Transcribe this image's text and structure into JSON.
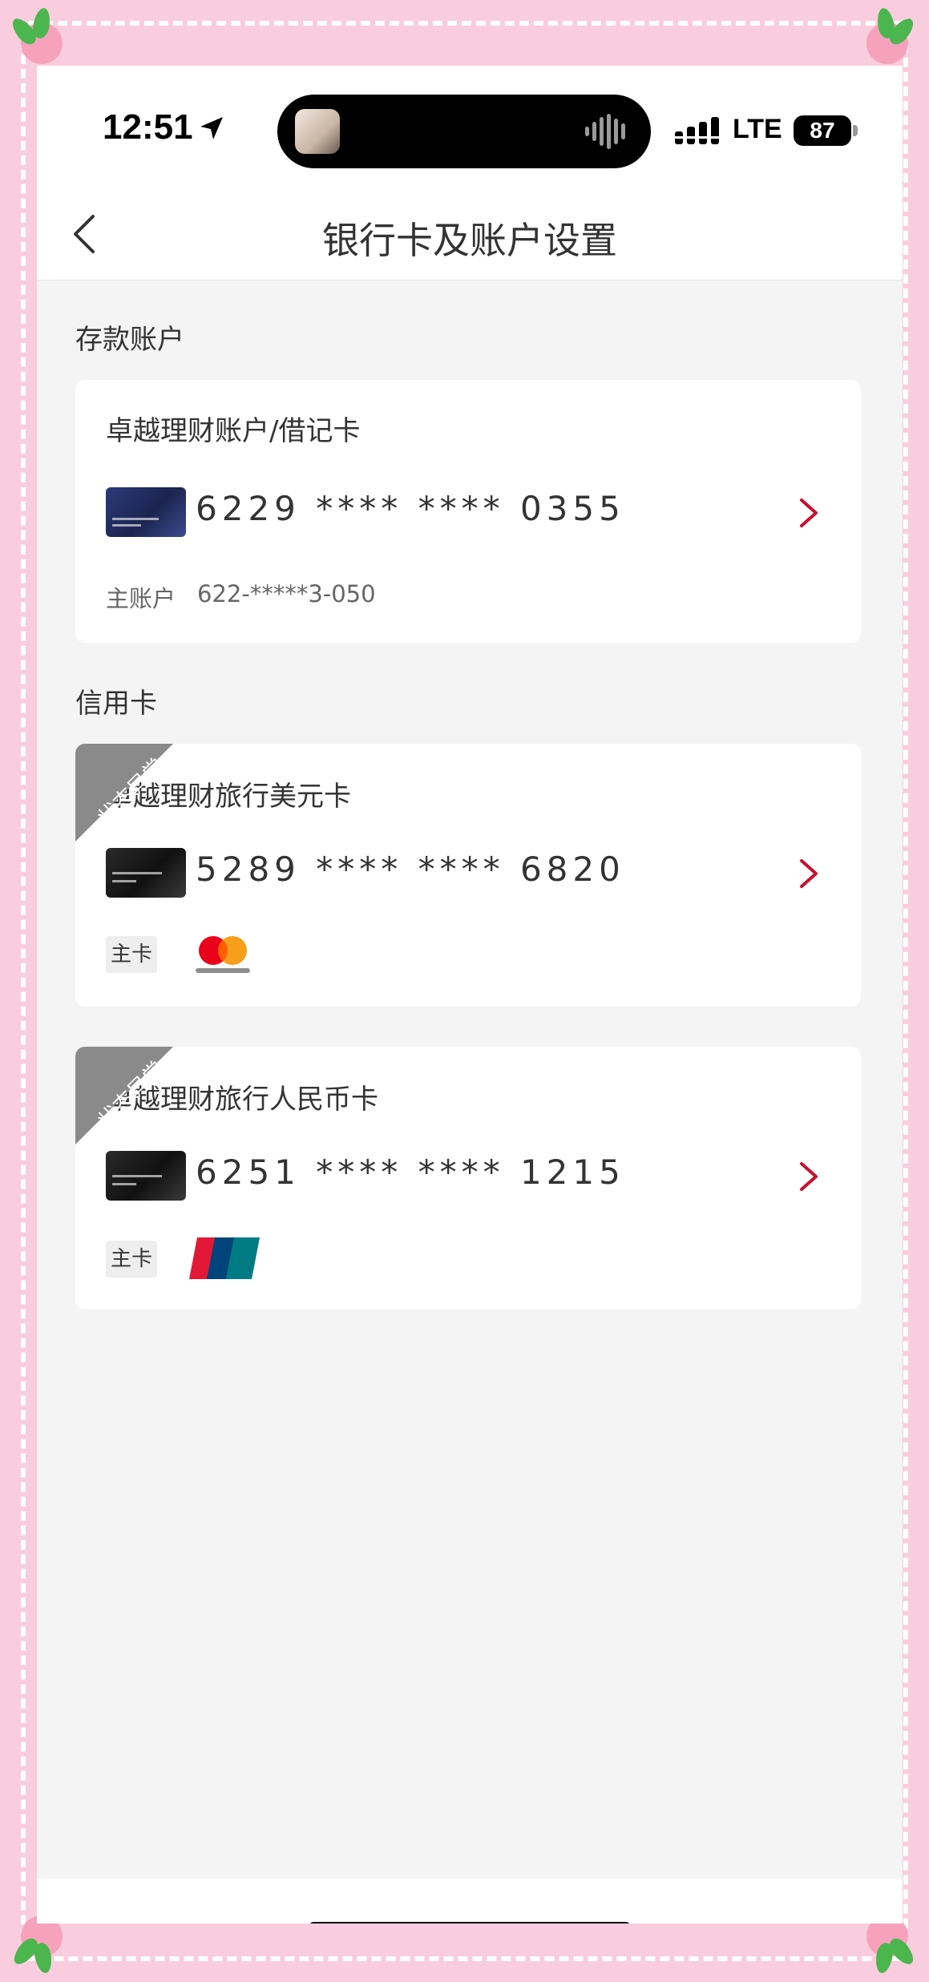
{
  "status_bar": {
    "time": "12:51",
    "network": "LTE",
    "battery": "87"
  },
  "nav": {
    "title": "银行卡及账户设置"
  },
  "savings_section": {
    "label": "存款账户",
    "card": {
      "title": "卓越理财账户/借记卡",
      "number": "6229 **** **** 0355",
      "sub_label": "主账户",
      "sub_value": "622-*****3-050"
    }
  },
  "credit_section": {
    "label": "信用卡",
    "cards": [
      {
        "title": "卓越理财旅行美元卡",
        "number": "5289 **** **** 6820",
        "ribbon": "状态异常",
        "badge": "主卡",
        "network_logo": "mastercard",
        "network_logo_icon": "mastercard-logo-icon"
      },
      {
        "title": "卓越理财旅行人民币卡",
        "number": "6251 **** **** 1215",
        "ribbon": "状态异常",
        "badge": "主卡",
        "network_logo": "UnionPay 银联",
        "network_logo_icon": "unionpay-logo-icon"
      }
    ]
  },
  "colors": {
    "accent_red": "#c8102e",
    "ribbon_gray": "#8a8a8a",
    "background": "#f4f4f4",
    "frame_pink": "#f9cddd"
  }
}
